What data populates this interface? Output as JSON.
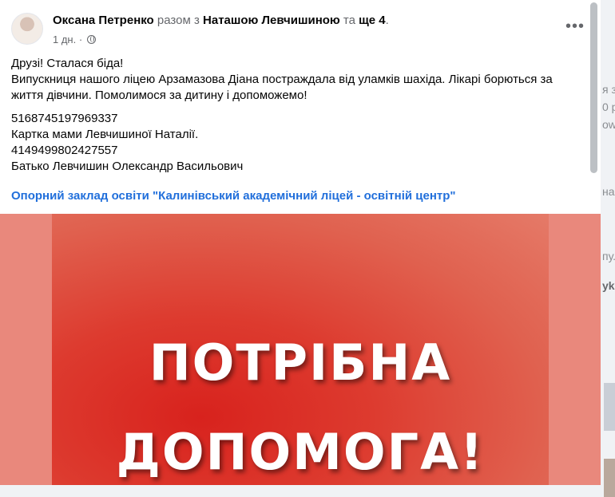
{
  "post": {
    "author": "Оксана Петренко",
    "with_text": "разом з",
    "tagged": "Наташою Левчишиною",
    "and_text": "та",
    "others": "ще 4",
    "period": ".",
    "time": "1 дн.",
    "separator": "·",
    "more_icon": "•••",
    "paragraph1": [
      "Друзі! Сталася біда!",
      "Випускниця нашого ліцею Арзамазова Діана постраждала від уламків шахіда. Лікарі борються за життя дівчини. Помолимося за дитину і допоможемо!"
    ],
    "paragraph2": [
      "5168745197969337",
      "Картка мами Левчишиної Наталії.",
      "4149499802427557",
      "Батько Левчишин Олександр Васильович"
    ],
    "page_link": "Опорний заклад освіти \"Калинівський академічний ліцей - освітній центр\"",
    "image_line1": "ПОТРІБНА",
    "image_line2": "ДОПОМОГА!"
  },
  "background": {
    "fragments": [
      "я з",
      "0 р",
      "ow",
      "на",
      "пу.",
      "yka"
    ]
  },
  "colors": {
    "link": "#216fdb",
    "secondary": "#65676b",
    "poster_red": "#d8221d"
  }
}
